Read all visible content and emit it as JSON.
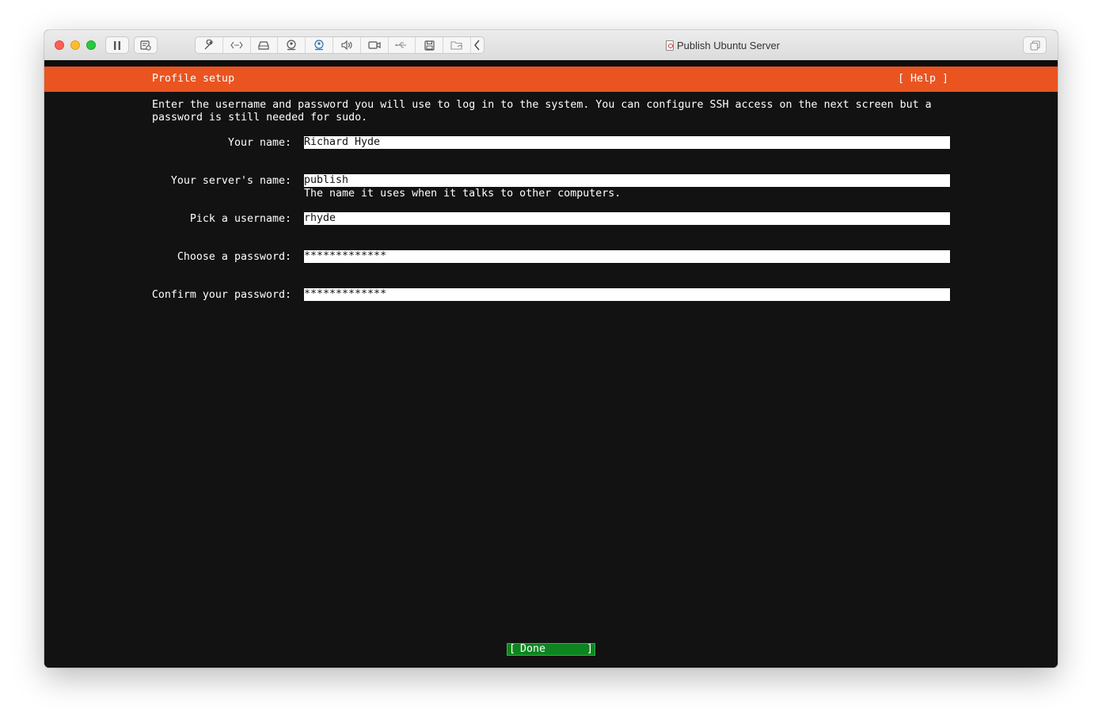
{
  "window": {
    "title": "Publish Ubuntu Server"
  },
  "toolbar": {
    "icons": [
      "pause-icon",
      "snapshot-icon",
      "wrench-icon",
      "code-icon",
      "drive-icon",
      "camera-icon",
      "network-icon",
      "sound-icon",
      "video-icon",
      "usb-icon",
      "floppy-icon",
      "folder-icon",
      "chevron-left-icon",
      "restore-icon"
    ]
  },
  "installer": {
    "header_title": "Profile setup",
    "help_label": "[ Help ]",
    "intro_line1": "Enter the username and password you will use to log in to the system. You can configure SSH access on the next screen but a",
    "intro_line2": "password is still needed for sudo.",
    "fields": [
      {
        "label": "Your name:",
        "value": "Richard Hyde"
      },
      {
        "label": "Your server's name:",
        "value": "publish",
        "hint": "The name it uses when it talks to other computers."
      },
      {
        "label": "Pick a username:",
        "value": "rhyde"
      },
      {
        "label": "Choose a password:",
        "value": "*************"
      },
      {
        "label": "Confirm your password:",
        "value": "*************"
      }
    ],
    "done_button": {
      "left_bracket": "[",
      "label": "Done",
      "right_bracket": "]"
    }
  },
  "colors": {
    "header": "#e95420",
    "background": "#121212",
    "done_button": "#0e8420"
  }
}
